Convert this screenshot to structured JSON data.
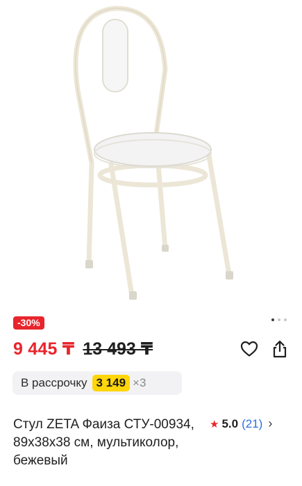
{
  "product": {
    "image_alt": "chair-photo",
    "discount_badge": "-30%",
    "gallery_dots": {
      "count": 3,
      "active": 1
    },
    "price_current": "9 445 ₸",
    "price_old": "13 493 ₸",
    "installment": {
      "label": "В рассрочку",
      "amount": "3 149",
      "multiplier": "×3"
    },
    "title": "Стул ZETA Фаиза СТУ-00934, 89x38x38 см, мультиколор, бежевый",
    "rating": {
      "value": "5.0",
      "count": "(21)"
    },
    "icons": {
      "favorite": "heart-icon",
      "share": "share-icon",
      "rating_star": "star-icon",
      "rating_more": "chevron-right-icon"
    }
  },
  "colors": {
    "accent_red": "#e8252c",
    "installment_yellow": "#ffd60a",
    "link_blue": "#2a6fdb"
  }
}
